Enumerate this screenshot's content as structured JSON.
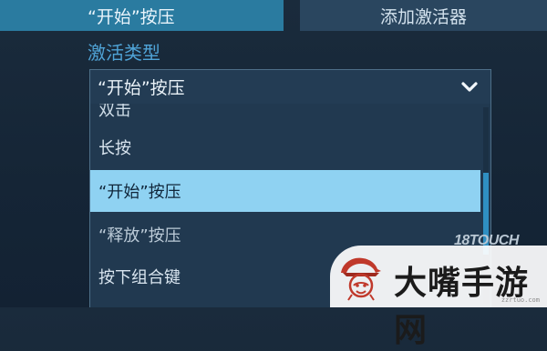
{
  "tabs": {
    "active_label": "“开始”按压",
    "add_activator_label": "添加激活器"
  },
  "activation": {
    "section_label": "激活类型",
    "selected_value": "“开始”按压"
  },
  "dropdown": {
    "options": [
      {
        "label": "双击"
      },
      {
        "label": "长按"
      },
      {
        "label": "“开始”按压",
        "selected": true
      },
      {
        "label": "“释放”按压"
      },
      {
        "label": "按下组合键"
      }
    ]
  },
  "icons": {
    "dropdown_chevron": "chevron-down-icon",
    "logo": "red-hat-head-logo"
  },
  "watermark": {
    "brand": "18TOUCH",
    "site_name": "大嘴手游网",
    "domain": "zzrtuo.com"
  },
  "colors": {
    "active_tab": "#2a7ba0",
    "label_blue": "#4fa3d6",
    "highlight": "#8fd2f2",
    "background": "#1a2b3c"
  }
}
